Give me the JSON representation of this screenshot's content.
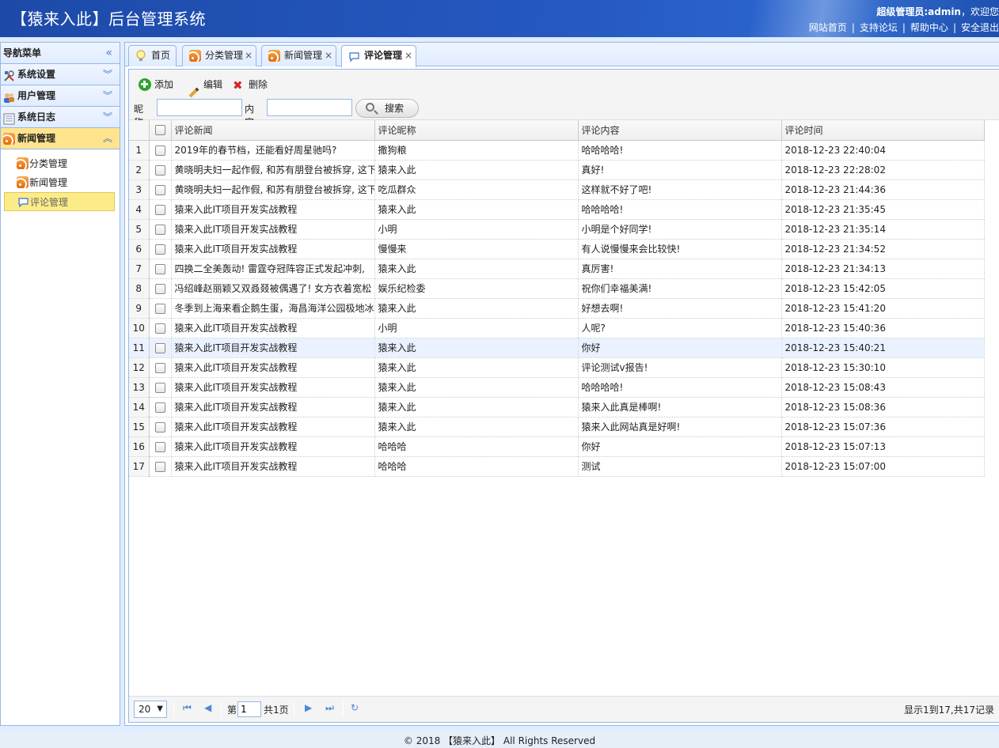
{
  "header": {
    "title": "【猿来入此】后台管理系统",
    "welcome_prefix": "超级管理员:",
    "welcome_user": "admin",
    "welcome_suffix": "，欢迎您",
    "links": [
      "网站首页",
      "支持论坛",
      "帮助中心",
      "安全退出"
    ]
  },
  "nav": {
    "title": "导航菜单",
    "sections": [
      {
        "label": "系统设置",
        "icon": "tools-icon"
      },
      {
        "label": "用户管理",
        "icon": "users-icon"
      },
      {
        "label": "系统日志",
        "icon": "log-icon"
      },
      {
        "label": "新闻管理",
        "icon": "rss-icon",
        "expanded": true
      }
    ],
    "news_items": [
      "分类管理",
      "新闻管理",
      "评论管理"
    ],
    "selected_item": "评论管理"
  },
  "tabs": [
    {
      "label": "首页",
      "icon": "bulb-icon",
      "closable": false
    },
    {
      "label": "分类管理",
      "icon": "rss-icon",
      "closable": true
    },
    {
      "label": "新闻管理",
      "icon": "rss-icon",
      "closable": true
    },
    {
      "label": "评论管理",
      "icon": "comment-icon",
      "closable": true,
      "active": true
    }
  ],
  "toolbar": {
    "add_label": "添加",
    "edit_label": "编辑",
    "delete_label": "删除",
    "nickname_label": "昵称:",
    "nickname_value": "",
    "content_label": "内容:",
    "content_value": "",
    "search_label": "搜索"
  },
  "grid": {
    "columns": [
      "评论新闻",
      "评论昵称",
      "评论内容",
      "评论时间"
    ],
    "highlighted_row": 11,
    "rows": [
      [
        "1",
        "2019年的春节档，还能看好周星驰吗?",
        "撒狗粮",
        "哈哈哈哈!",
        "2018-12-23 22:40:04"
      ],
      [
        "2",
        "黄晓明夫妇一起作假, 和苏有朋登台被拆穿, 这下",
        "猿来入此",
        "真好!",
        "2018-12-23 22:28:02"
      ],
      [
        "3",
        "黄晓明夫妇一起作假, 和苏有朋登台被拆穿, 这下",
        "吃瓜群众",
        "这样就不好了吧!",
        "2018-12-23 21:44:36"
      ],
      [
        "4",
        "猿来入此IT项目开发实战教程",
        "猿来入此",
        "哈哈哈哈!",
        "2018-12-23 21:35:45"
      ],
      [
        "5",
        "猿来入此IT项目开发实战教程",
        "小明",
        "小明是个好同学!",
        "2018-12-23 21:35:14"
      ],
      [
        "6",
        "猿来入此IT项目开发实战教程",
        "慢慢来",
        "有人说慢慢来会比较快!",
        "2018-12-23 21:34:52"
      ],
      [
        "7",
        "四换二全美轰动! 雷霆夺冠阵容正式发起冲刺,",
        "猿来入此",
        "真厉害!",
        "2018-12-23 21:34:13"
      ],
      [
        "8",
        "冯绍峰赵丽颖又双叒叕被偶遇了! 女方衣着宽松",
        "娱乐纪检委",
        "祝你们幸福美满!",
        "2018-12-23 15:42:05"
      ],
      [
        "9",
        "冬季到上海来看企鹅生蛋，海昌海洋公园极地冰",
        "猿来入此",
        "好想去啊!",
        "2018-12-23 15:41:20"
      ],
      [
        "10",
        "猿来入此IT项目开发实战教程",
        "小明",
        "人呢?",
        "2018-12-23 15:40:36"
      ],
      [
        "11",
        "猿来入此IT项目开发实战教程",
        "猿来入此",
        "你好",
        "2018-12-23 15:40:21"
      ],
      [
        "12",
        "猿来入此IT项目开发实战教程",
        "猿来入此",
        "评论测试v报告!",
        "2018-12-23 15:30:10"
      ],
      [
        "13",
        "猿来入此IT项目开发实战教程",
        "猿来入此",
        "哈哈哈哈!",
        "2018-12-23 15:08:43"
      ],
      [
        "14",
        "猿来入此IT项目开发实战教程",
        "猿来入此",
        "猿来入此真是棒啊!",
        "2018-12-23 15:08:36"
      ],
      [
        "15",
        "猿来入此IT项目开发实战教程",
        "猿来入此",
        "猿来入此网站真是好啊!",
        "2018-12-23 15:07:36"
      ],
      [
        "16",
        "猿来入此IT项目开发实战教程",
        "哈哈哈",
        "你好",
        "2018-12-23 15:07:13"
      ],
      [
        "17",
        "猿来入此IT项目开发实战教程",
        "哈哈哈",
        "测试",
        "2018-12-23 15:07:00"
      ]
    ]
  },
  "pager": {
    "page_size": "20",
    "page_prefix": "第",
    "page_value": "1",
    "page_suffix": "共1页",
    "info": "显示1到17,共17记录"
  },
  "footer": {
    "text": "© 2018 【猿来入此】 All Rights Reserved"
  },
  "colors": {
    "header_blue": "#2558c0",
    "panel_border": "#95b8e7",
    "selected_yellow": "#fbec88"
  }
}
